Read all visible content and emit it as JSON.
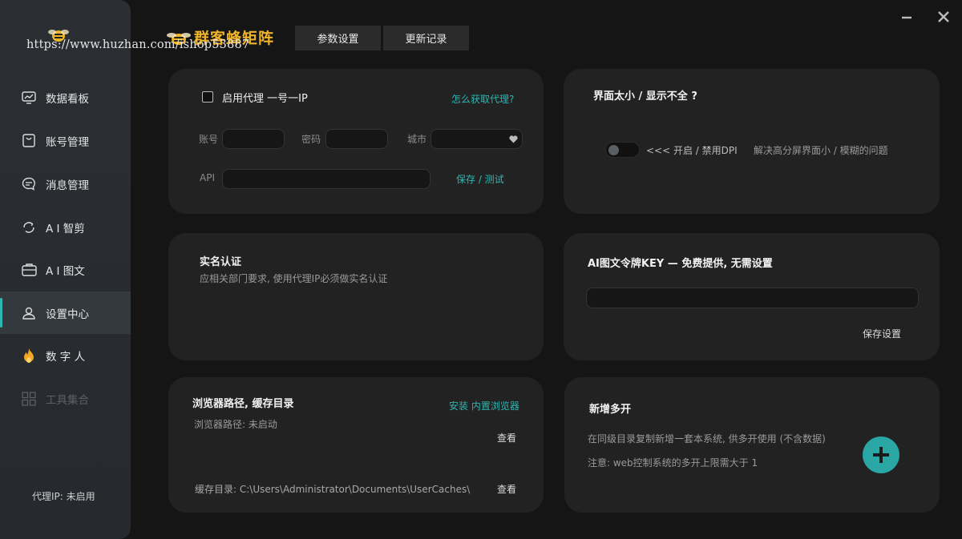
{
  "watermark": "https://www.huzhan.com/ishop53887",
  "brand": {
    "name": "群客蜂矩阵"
  },
  "top_tabs": [
    {
      "label": "参数设置"
    },
    {
      "label": "更新记录"
    }
  ],
  "sidebar": {
    "items": [
      {
        "label": "数据看板",
        "icon": "chart-monitor-icon"
      },
      {
        "label": "账号管理",
        "icon": "account-bag-icon"
      },
      {
        "label": "消息管理",
        "icon": "chat-bubble-icon"
      },
      {
        "label": "A I 智剪",
        "icon": "refresh-cut-icon"
      },
      {
        "label": "A I 图文",
        "icon": "briefcase-icon"
      },
      {
        "label": "设置中心",
        "icon": "user-settings-icon",
        "active": true
      },
      {
        "label": "数 字 人",
        "icon": "flame-icon"
      },
      {
        "label": "工具集合",
        "icon": "grid-icon",
        "disabled": true
      }
    ],
    "proxy_status": "代理IP: 未启用"
  },
  "proxy_card": {
    "checkbox_label": "启用代理  一号一IP",
    "help_link": "怎么获取代理?",
    "account_label": "账号",
    "password_label": "密码",
    "city_label": "城市",
    "api_label": "API",
    "save_test": "保存 / 测试"
  },
  "dpi_card": {
    "title": "界面太小 / 显示不全 ?",
    "toggle_label": "<<< 开启 / 禁用DPI",
    "description": "解决高分屏界面小 / 模糊的问题"
  },
  "realname_card": {
    "title": "实名认证",
    "description": "应相关部门要求, 使用代理IP必须做实名认证"
  },
  "key_card": {
    "title": "AI图文令牌KEY — 免费提供, 无需设置",
    "save": "保存设置"
  },
  "browser_card": {
    "title": "浏览器路径, 缓存目录",
    "install_link": "安装 内置浏览器",
    "browser_path": "浏览器路径: 未启动",
    "view1": "查看",
    "cache_dir": "缓存目录:  C:\\Users\\Administrator\\Documents\\UserCaches\\",
    "view2": "查看"
  },
  "multi_card": {
    "title": "新增多开",
    "line1": "在同级目录复制新增一套本系统, 供多开使用 (不含数据)",
    "line2": "注意: web控制系统的多开上限需大于 1"
  },
  "colors": {
    "accent": "#2fb6b3",
    "brand": "#f0b429",
    "bg": "#151515",
    "card": "#222222"
  }
}
